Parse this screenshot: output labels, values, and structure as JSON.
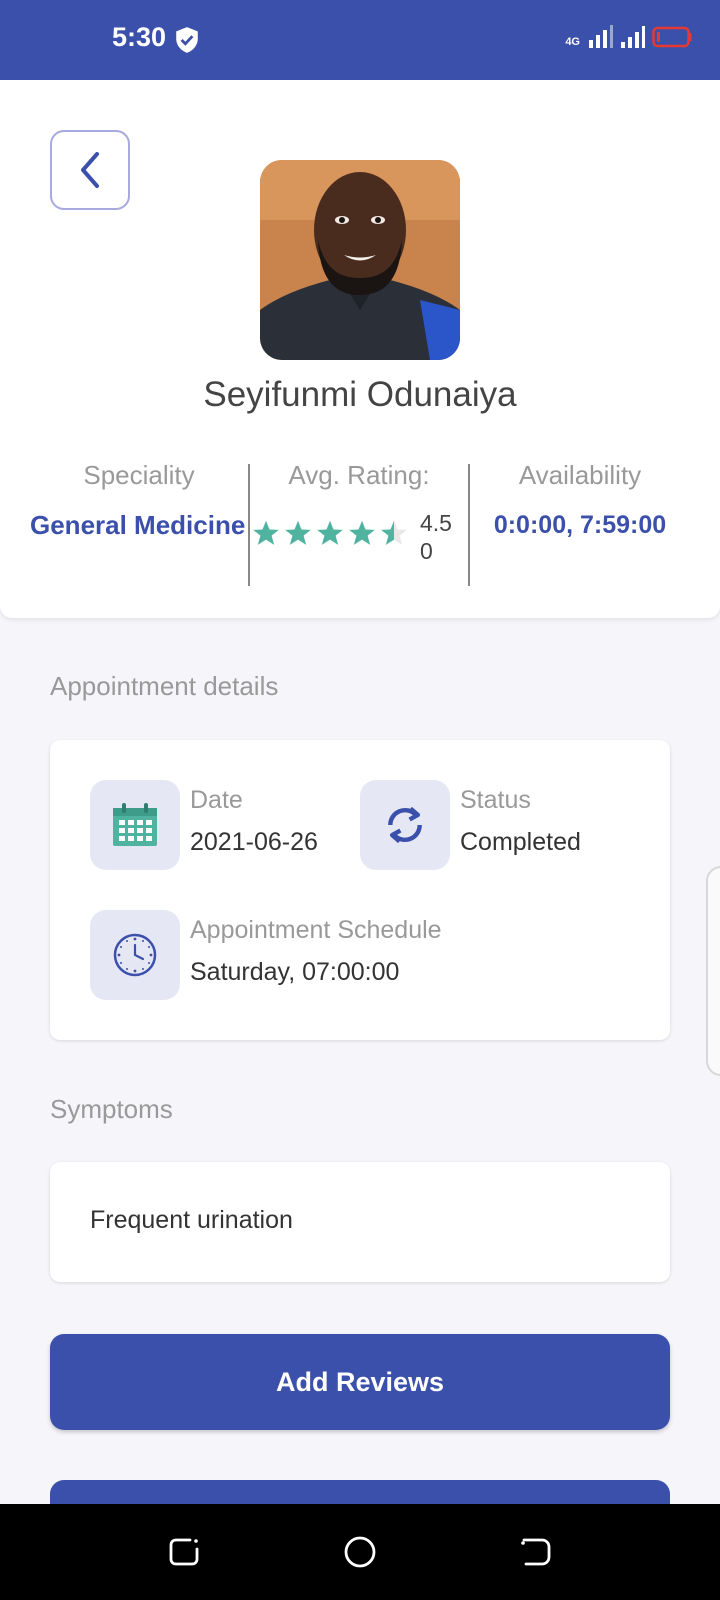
{
  "status_bar": {
    "time": "5:30",
    "network": "4G"
  },
  "doctor": {
    "name": "Seyifunmi Odunaiya",
    "speciality_label": "Speciality",
    "speciality": "General Medicine",
    "rating_label": "Avg. Rating:",
    "rating": "4.50",
    "availability_label": "Availability",
    "availability": "0:0:00, 7:59:00"
  },
  "appointment": {
    "section_title": "Appointment details",
    "date_label": "Date",
    "date": "2021-06-26",
    "status_label": "Status",
    "status": "Completed",
    "schedule_label": "Appointment Schedule",
    "schedule": "Saturday, 07:00:00"
  },
  "symptoms": {
    "section_title": "Symptoms",
    "text": "Frequent urination"
  },
  "actions": {
    "add_reviews": "Add Reviews"
  },
  "colors": {
    "primary": "#3b50ab",
    "star": "#4fb3a0",
    "icon_bg": "#e6e7f4"
  }
}
